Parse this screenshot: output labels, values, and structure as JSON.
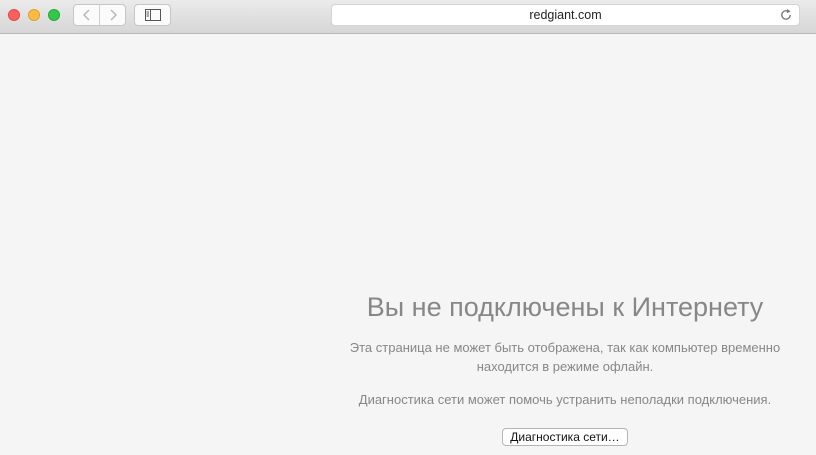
{
  "window": {
    "controls": [
      "close",
      "minimize",
      "maximize"
    ]
  },
  "toolbar": {
    "back_icon": "chevron-left-icon",
    "forward_icon": "chevron-right-icon",
    "sidebar_icon": "sidebar-icon",
    "reload_icon": "reload-icon"
  },
  "address_bar": {
    "url": "redgiant.com"
  },
  "error_page": {
    "headline": "Вы не подключены к Интернету",
    "description": "Эта страница не может быть отображена, так как компьютер временно находится в режиме офлайн.",
    "hint": "Диагностика сети может помочь устранить неполадки подключения.",
    "button_label": "Диагностика сети…"
  },
  "colors": {
    "close": "#fc605c",
    "minimize": "#fdbc40",
    "maximize": "#34c84a",
    "message_text": "#878787",
    "page_background": "#f5f5f5"
  }
}
